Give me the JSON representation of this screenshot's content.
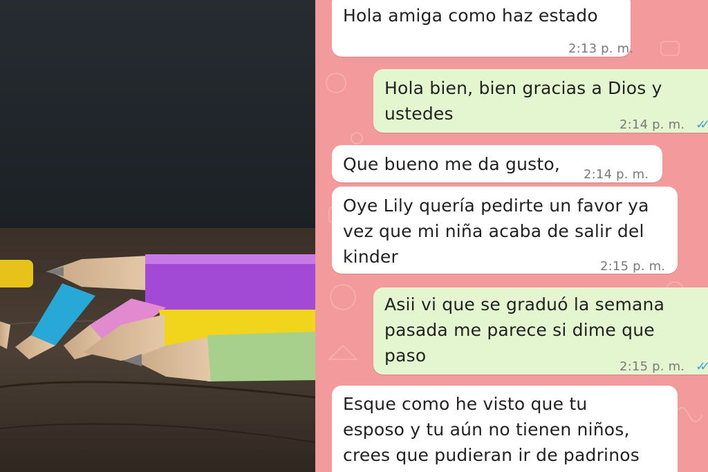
{
  "photo": {
    "subject": "colored-pencils"
  },
  "colors": {
    "chat_background": "#f29a9c",
    "incoming_bubble": "#ffffff",
    "outgoing_bubble": "#e4f6cf",
    "read_ticks": "#3fa2d8"
  },
  "messages": [
    {
      "direction": "incoming",
      "text": "Hola amiga como haz estado",
      "time": "2:13 p. m."
    },
    {
      "direction": "outgoing",
      "text": "Hola bien, bien gracias a Dios y\nustedes",
      "time": "2:14 p. m.",
      "status": "read"
    },
    {
      "direction": "incoming",
      "text": "Que bueno me da gusto,",
      "time": "2:14 p. m."
    },
    {
      "direction": "incoming",
      "text": "Oye Lily quería pedirte un favor ya\nvez que mi niña acaba de salir del\nkinder",
      "time": "2:15 p. m."
    },
    {
      "direction": "outgoing",
      "text": "Asii vi que se graduó la semana\npasada me parece si dime que\npaso",
      "time": "2:15 p. m.",
      "status": "read"
    },
    {
      "direction": "incoming",
      "text": "Esque como he visto que tu\nesposo y tu aún no tienen niños,\ncrees que pudieran ir de padrinos",
      "time": ""
    }
  ]
}
